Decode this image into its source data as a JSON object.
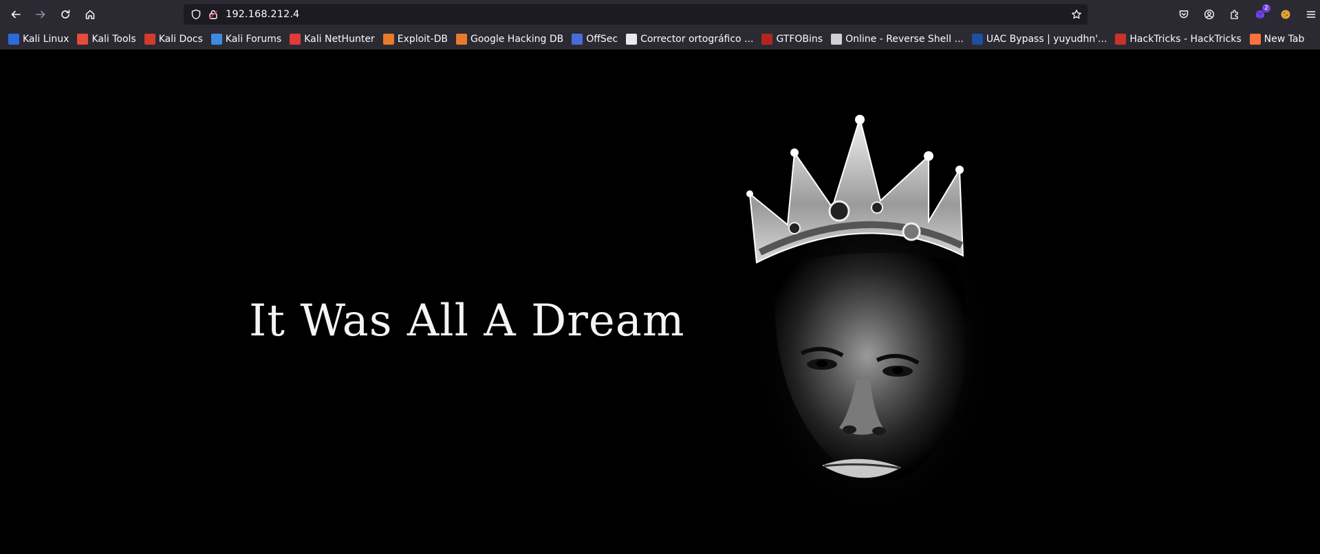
{
  "browser": {
    "url": "192.168.212.4",
    "extensions_badge": "2"
  },
  "bookmarks": [
    {
      "label": "Kali Linux",
      "icon": "kali-dragon-icon",
      "color": "#2c6bd8"
    },
    {
      "label": "Kali Tools",
      "icon": "kali-tools-icon",
      "color": "#e84b3c"
    },
    {
      "label": "Kali Docs",
      "icon": "kali-docs-icon",
      "color": "#d33a2c"
    },
    {
      "label": "Kali Forums",
      "icon": "kali-forums-icon",
      "color": "#3d8be0"
    },
    {
      "label": "Kali NetHunter",
      "icon": "nethunter-icon",
      "color": "#e23a3a"
    },
    {
      "label": "Exploit-DB",
      "icon": "exploit-db-icon",
      "color": "#e87a2b"
    },
    {
      "label": "Google Hacking DB",
      "icon": "ghdb-icon",
      "color": "#e87a2b"
    },
    {
      "label": "OffSec",
      "icon": "offsec-icon",
      "color": "#4a6bd8"
    },
    {
      "label": "Corrector ortográfico ...",
      "icon": "corrector-icon",
      "color": "#e8e8ef"
    },
    {
      "label": "GTFOBins",
      "icon": "gtfobins-icon",
      "color": "#b3261e"
    },
    {
      "label": "Online - Reverse Shell ...",
      "icon": "skull-icon",
      "color": "#cfcfd8"
    },
    {
      "label": "UAC Bypass | yuyudhn'...",
      "icon": "uac-bypass-icon",
      "color": "#1e4fa0"
    },
    {
      "label": "HackTricks - HackTricks",
      "icon": "hacktricks-icon",
      "color": "#c8332b"
    },
    {
      "label": "New Tab",
      "icon": "firefox-icon",
      "color": "#ff7139"
    }
  ],
  "page": {
    "headline": "It Was All A Dream"
  }
}
